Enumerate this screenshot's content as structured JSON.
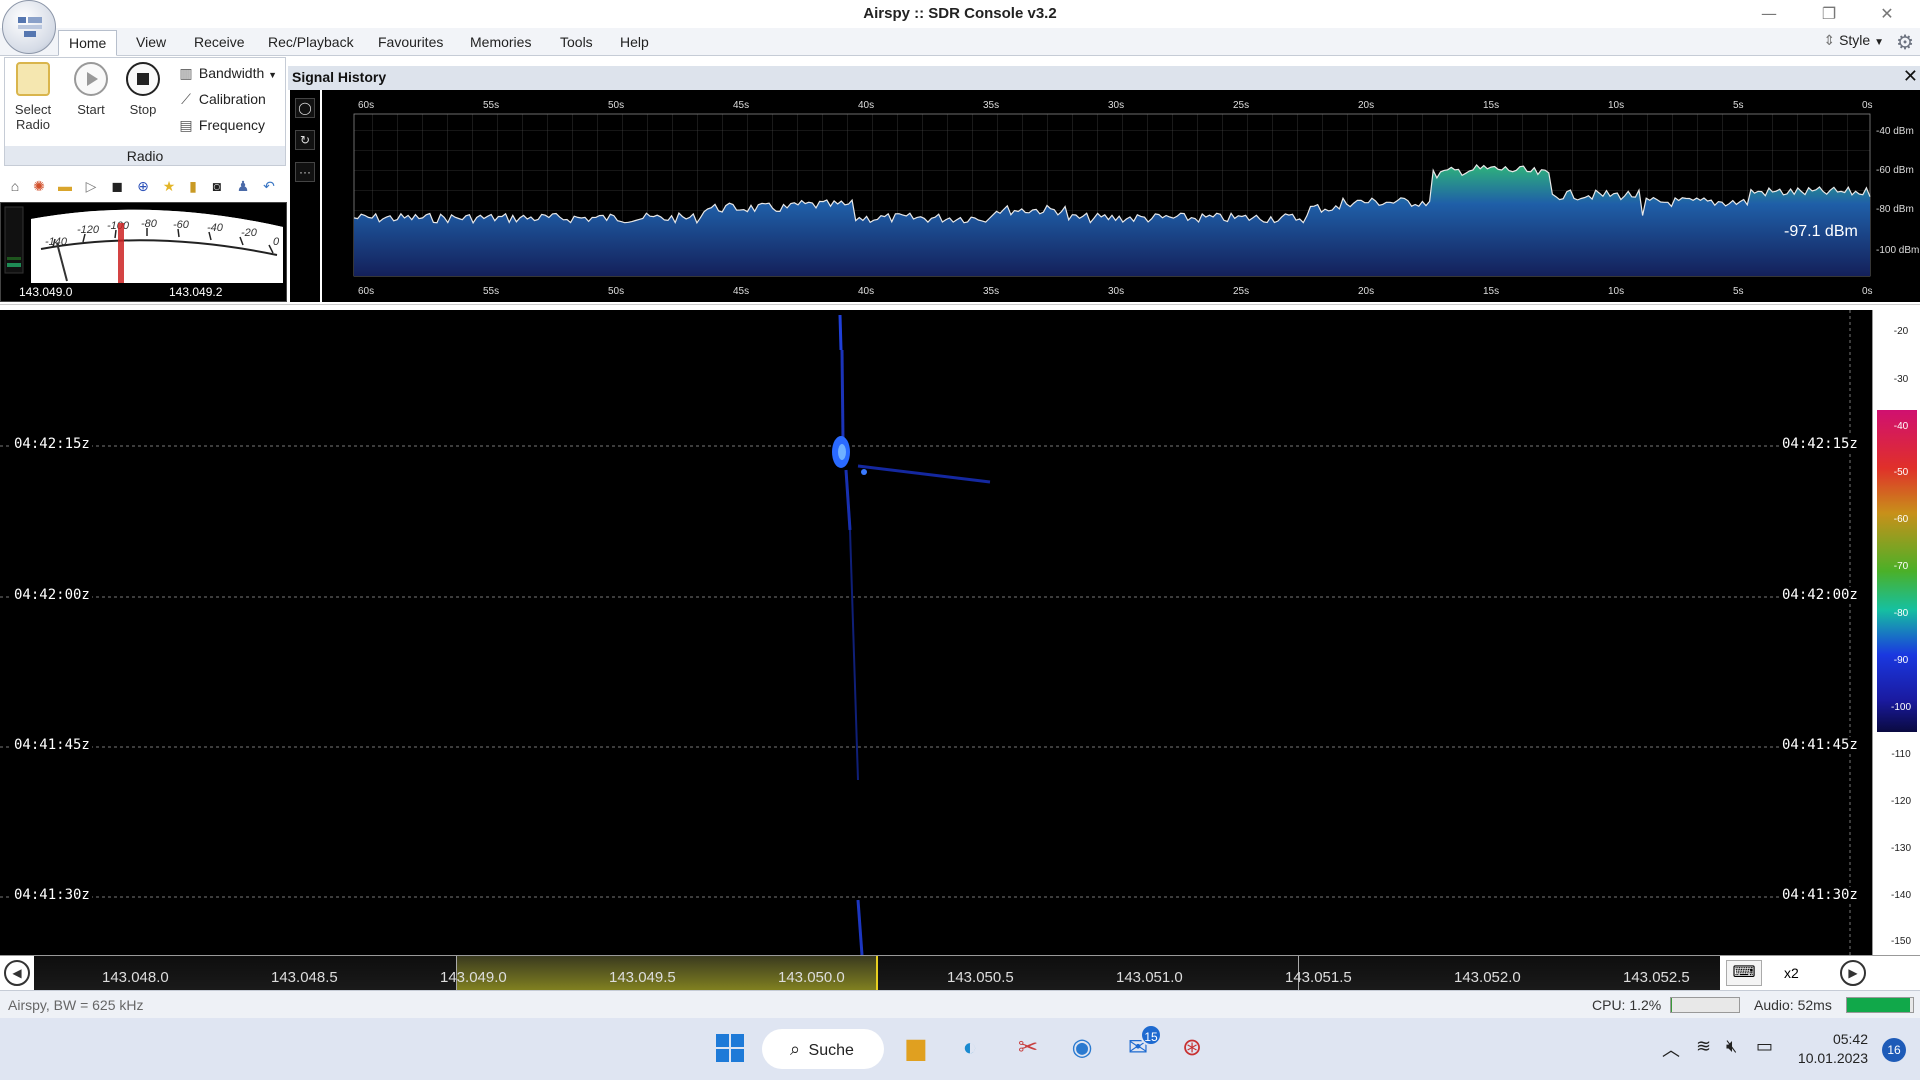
{
  "window": {
    "title": "Airspy :: SDR Console v3.2",
    "minimize_glyph": "—",
    "restore_glyph": "❐",
    "close_glyph": "✕"
  },
  "menu": {
    "tabs": [
      "Home",
      "View",
      "Receive",
      "Rec/Playback",
      "Favourites",
      "Memories",
      "Tools",
      "Help"
    ],
    "style_label": "Style"
  },
  "ribbon": {
    "select_radio_line1": "Select",
    "select_radio_line2": "Radio",
    "start_label": "Start",
    "stop_label": "Stop",
    "bandwidth_label": "Bandwidth",
    "calibration_label": "Calibration",
    "frequency_label": "Frequency",
    "group_label": "Radio"
  },
  "smeter": {
    "scale_labels": [
      "-140",
      "-120",
      "-100",
      "-80",
      "-60",
      "-40",
      "-20",
      "0"
    ],
    "freq_left": "143.049.0",
    "freq_right": "143.049.2"
  },
  "signal_history": {
    "title": "Signal History",
    "time_labels": [
      "60s",
      "55s",
      "50s",
      "45s",
      "40s",
      "35s",
      "30s",
      "25s",
      "20s",
      "15s",
      "10s",
      "5s",
      "0s"
    ],
    "dbm_labels": [
      "-40 dBm",
      "-60 dBm",
      "-80 dBm",
      "-100 dBm"
    ],
    "current_reading": "-97.1 dBm",
    "ctl_record": "◯",
    "ctl_refresh": "↻",
    "ctl_more": "···"
  },
  "waterfall": {
    "timestamps": [
      "04:42:15z",
      "04:42:00z",
      "04:41:45z",
      "04:41:30z"
    ]
  },
  "scale": {
    "labels": [
      "-20",
      "-30",
      "-40",
      "-50",
      "-60",
      "-70",
      "-80",
      "-90",
      "-100",
      "-110",
      "-120",
      "-130",
      "-140",
      "-150"
    ]
  },
  "frequency_axis": {
    "labels": [
      "143.048.0",
      "143.048.5",
      "143.049.0",
      "143.049.5",
      "143.050.0",
      "143.050.5",
      "143.051.0",
      "143.051.5",
      "143.052.0",
      "143.052.5"
    ],
    "zoom": "x2"
  },
  "status": {
    "device": "Airspy, BW = 625 kHz",
    "cpu": "CPU: 1.2%",
    "audio": "Audio: 52ms",
    "cpu_fraction": 0.012,
    "audio_fraction": 0.95
  },
  "taskbar": {
    "search_label": "Suche",
    "mail_badge": "15",
    "time": "05:42",
    "date": "10.01.2023",
    "notification_count": "16"
  },
  "colors": {
    "accent": "#1e5bb8",
    "waterfall_signal": "#2a52ff",
    "history_fill": "#1d3c8c",
    "history_peak": "#2fb37a"
  }
}
